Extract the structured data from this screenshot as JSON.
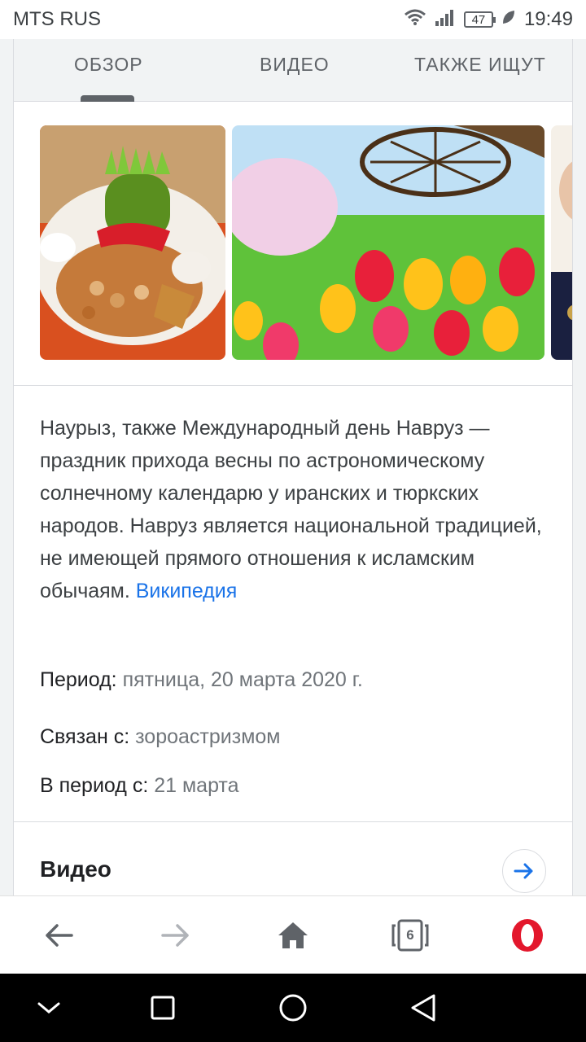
{
  "status_bar": {
    "carrier": "MTS RUS",
    "battery": "47",
    "time": "19:49"
  },
  "tabs": [
    {
      "label": "ОБЗОР"
    },
    {
      "label": "ВИДЕО"
    },
    {
      "label": "ТАКЖЕ ИЩУТ"
    }
  ],
  "description": {
    "text": "Наурыз, также Международный день Навруз — праздник прихода весны по астрономическому солнечному календарю у иранских и тюркских народов. Навруз является национальной традицией, не имеющей прямого отношения к исламским обычаям. ",
    "source_link": "Википедия"
  },
  "facts": [
    {
      "label": "Период:",
      "value": "пятница, 20 марта 2020 г."
    },
    {
      "label": "Связан с:",
      "value": "зороастризмом"
    },
    {
      "label": "В период с:",
      "value": "21 марта"
    }
  ],
  "video_section": {
    "title": "Видео"
  },
  "browser_bar": {
    "tab_count": "6"
  },
  "icons": {
    "wifi": "wifi-icon",
    "signal": "signal-icon",
    "leaf": "leaf-icon",
    "back": "arrow-left-icon",
    "forward": "arrow-right-icon",
    "home": "home-icon",
    "tabs": "tabs-icon",
    "opera": "opera-logo-icon"
  },
  "colors": {
    "link": "#1a73e8",
    "opera_red": "#e3172c"
  }
}
